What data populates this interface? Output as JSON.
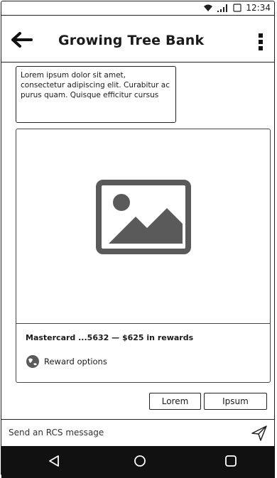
{
  "status_bar": {
    "time": "12:34",
    "icons": [
      "wifi-icon",
      "signal-icon",
      "battery-icon"
    ]
  },
  "app_bar": {
    "title": "Growing Tree Bank",
    "back_icon": "arrow-left-icon",
    "menu_icon": "more-vertical-icon"
  },
  "message": {
    "text": "Lorem ipsum dolor sit amet, consectetur adipiscing elit. Curabitur ac purus quam. Quisque efficitur cursus"
  },
  "rich_card": {
    "media_icon": "image-placeholder-icon",
    "title": "Mastercard ...5632 — $625 in rewards",
    "option_icon": "globe-icon",
    "option_label": "Reward options"
  },
  "suggestions": [
    "Lorem",
    "Ipsum"
  ],
  "composer": {
    "placeholder": "Send an RCS message",
    "send_icon": "send-icon"
  },
  "nav_bar": {
    "icons": [
      "back-triangle-icon",
      "home-circle-icon",
      "recents-square-icon"
    ]
  }
}
